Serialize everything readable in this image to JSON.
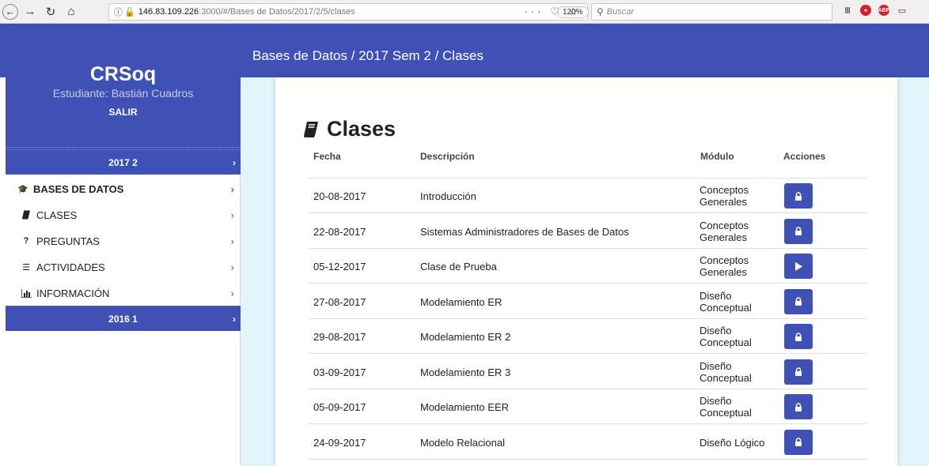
{
  "browser": {
    "url_info": "ⓘ",
    "url_host": "146.83.109.226",
    "url_path": ":3000/#/Bases de Datos/2017/2/5/clases",
    "zoom": "120%",
    "search_placeholder": "Buscar"
  },
  "header": {
    "breadcrumb": "Bases de Datos / 2017 Sem 2 / Clases"
  },
  "sidebar": {
    "brand": "CRSoq",
    "student": "Estudiante: Bastián Cuadros",
    "logout": "SALIR",
    "terms": [
      {
        "label": "2017 2"
      },
      {
        "label": "2016 1"
      }
    ],
    "course": "BASES DE DATOS",
    "items": [
      {
        "label": "CLASES",
        "icon": "book-icon"
      },
      {
        "label": "PREGUNTAS",
        "icon": "question-icon"
      },
      {
        "label": "ACTIVIDADES",
        "icon": "list-icon"
      },
      {
        "label": "INFORMACIÓN",
        "icon": "bar-chart-icon"
      }
    ]
  },
  "main": {
    "title": "Clases",
    "columns": [
      "Fecha",
      "Descripción",
      "Módulo",
      "Acciones"
    ],
    "rows": [
      {
        "date": "20-08-2017",
        "description": "Introducción",
        "module_1": "Conceptos",
        "module_2": "Generales",
        "action": "lock-icon"
      },
      {
        "date": "22-08-2017",
        "description": "Sistemas Administradores de Bases de Datos",
        "module_1": "Conceptos",
        "module_2": "Generales",
        "action": "lock-icon"
      },
      {
        "date": "05-12-2017",
        "description": "Clase de Prueba",
        "module_1": "Conceptos",
        "module_2": "Generales",
        "action": "play-icon"
      },
      {
        "date": "27-08-2017",
        "description": "Modelamiento ER",
        "module_1": "Diseño",
        "module_2": "Conceptual",
        "action": "lock-icon"
      },
      {
        "date": "29-08-2017",
        "description": "Modelamiento ER 2",
        "module_1": "Diseño",
        "module_2": "Conceptual",
        "action": "lock-icon"
      },
      {
        "date": "03-09-2017",
        "description": "Modelamiento ER 3",
        "module_1": "Diseño",
        "module_2": "Conceptual",
        "action": "lock-icon"
      },
      {
        "date": "05-09-2017",
        "description": "Modelamiento EER",
        "module_1": "Diseño",
        "module_2": "Conceptual",
        "action": "lock-icon"
      },
      {
        "date": "24-09-2017",
        "description": "Modelo Relacional",
        "module_1": "Diseño Lógico",
        "module_2": "",
        "action": "lock-icon"
      }
    ]
  },
  "colors": {
    "primary": "#3f51b5",
    "content_bg": "#e1f5fd"
  }
}
